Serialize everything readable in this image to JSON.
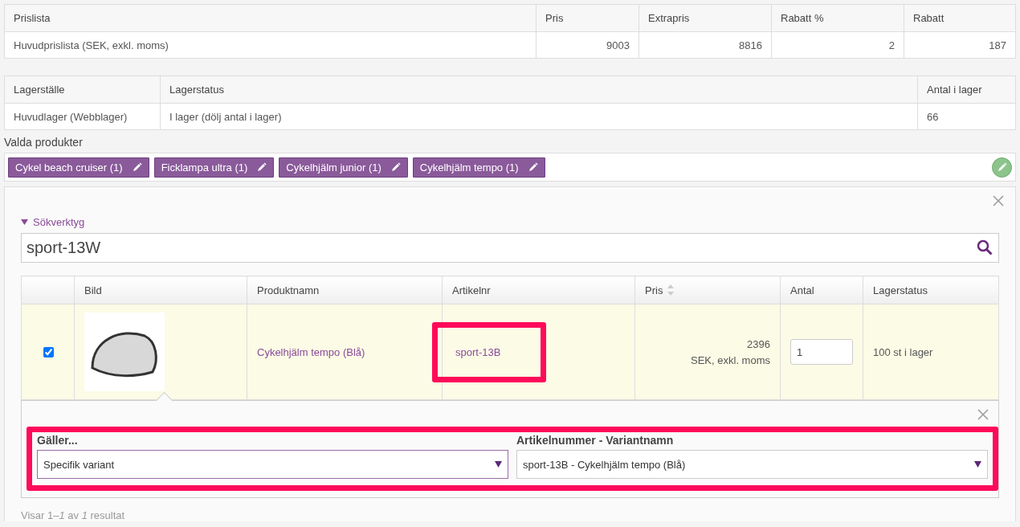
{
  "price_table": {
    "columns": [
      "Prislista",
      "Pris",
      "Extrapris",
      "Rabatt %",
      "Rabatt"
    ],
    "rows": [
      [
        "Huvudprislista (SEK, exkl. moms)",
        "9003",
        "8816",
        "2",
        "187"
      ]
    ]
  },
  "stock_table": {
    "columns": [
      "Lagerställe",
      "Lagerstatus",
      "Antal i lager"
    ],
    "rows": [
      [
        "Huvudlager (Webblager)",
        "I lager (dölj antal i lager)",
        "66"
      ]
    ]
  },
  "selected_products": {
    "label": "Valda produkter",
    "chips": [
      {
        "label": "Cykel beach cruiser (1)"
      },
      {
        "label": "Ficklampa ultra (1)"
      },
      {
        "label": "Cykelhjälm junior (1)"
      },
      {
        "label": "Cykelhjälm tempo (1)"
      }
    ]
  },
  "search_panel": {
    "toggle": "Sökverktyg",
    "expanded": true,
    "query": "sport-13W"
  },
  "results": {
    "columns": [
      {
        "sortable": false
      },
      {
        "label": "Bild",
        "sortable": false
      },
      {
        "label": "Produktnamn",
        "sortable": false
      },
      {
        "label": "Artikelnr",
        "sortable": false
      },
      {
        "label": "Pris",
        "sortable": true
      },
      {
        "label": "Antal",
        "sortable": false
      },
      {
        "label": "Lagerstatus",
        "sortable": false
      }
    ],
    "rows": [
      {
        "checked": true,
        "product_name": "Cykelhjälm tempo (Blå)",
        "article_no": "sport-13B",
        "price": "2396",
        "price_note": "SEK, exkl. moms",
        "quantity": "1",
        "stock": "100 st i lager"
      }
    ]
  },
  "variant_popup": {
    "fields": [
      {
        "label": "Gäller...",
        "value": "Specifik variant",
        "focused": true
      },
      {
        "label": "Artikelnummer - Variantnamn",
        "value": "sport-13B - Cykelhjälm tempo (Blå)",
        "focused": false
      }
    ]
  },
  "footer": "Visar 1–*1* av *1* resultat"
}
